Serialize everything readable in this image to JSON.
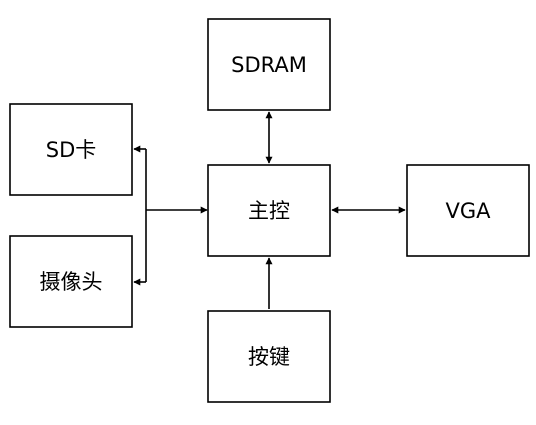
{
  "diagram": {
    "nodes": {
      "sdram": {
        "label": "SDRAM"
      },
      "sd_card": {
        "label": "SD卡"
      },
      "main_control": {
        "label": "主控"
      },
      "vga": {
        "label": "VGA"
      },
      "camera": {
        "label": "摄像头"
      },
      "buttons": {
        "label": "按键"
      }
    },
    "edges": [
      {
        "from": "sdram",
        "to": "main_control",
        "direction": "both"
      },
      {
        "from": "main_control",
        "to": "vga",
        "direction": "both"
      },
      {
        "from": "buttons",
        "to": "main_control",
        "direction": "forward"
      },
      {
        "from": "sd_card",
        "to": "main_control",
        "direction": "both"
      },
      {
        "from": "camera",
        "to": "main_control",
        "direction": "both"
      }
    ]
  }
}
